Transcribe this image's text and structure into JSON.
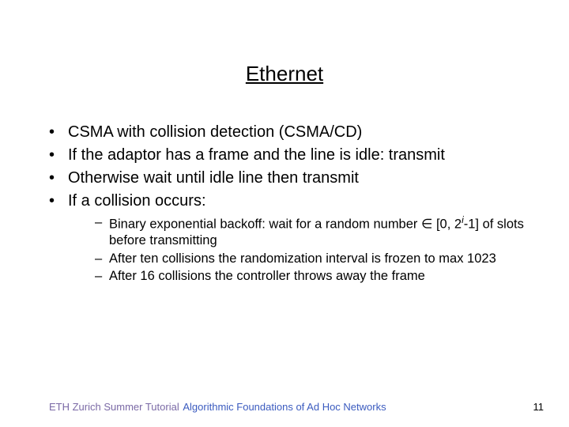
{
  "title": "Ethernet",
  "bullets": {
    "b0": "CSMA with collision detection (CSMA/CD)",
    "b1": "If the adaptor has a frame and the line is idle: transmit",
    "b2": "Otherwise wait until idle line then transmit",
    "b3": "If a collision occurs:"
  },
  "sub": {
    "s0_pre": "Binary exponential backoff: wait for a random number ∈ [0, 2",
    "s0_sup": "i",
    "s0_post": "-1] of slots before transmitting",
    "s1": "After ten collisions the randomization interval is frozen to max 1023",
    "s2": "After 16 collisions the controller throws away the frame"
  },
  "footer": {
    "left": "ETH Zurich Summer Tutorial",
    "center": "Algorithmic Foundations of Ad Hoc Networks",
    "right": "11"
  }
}
